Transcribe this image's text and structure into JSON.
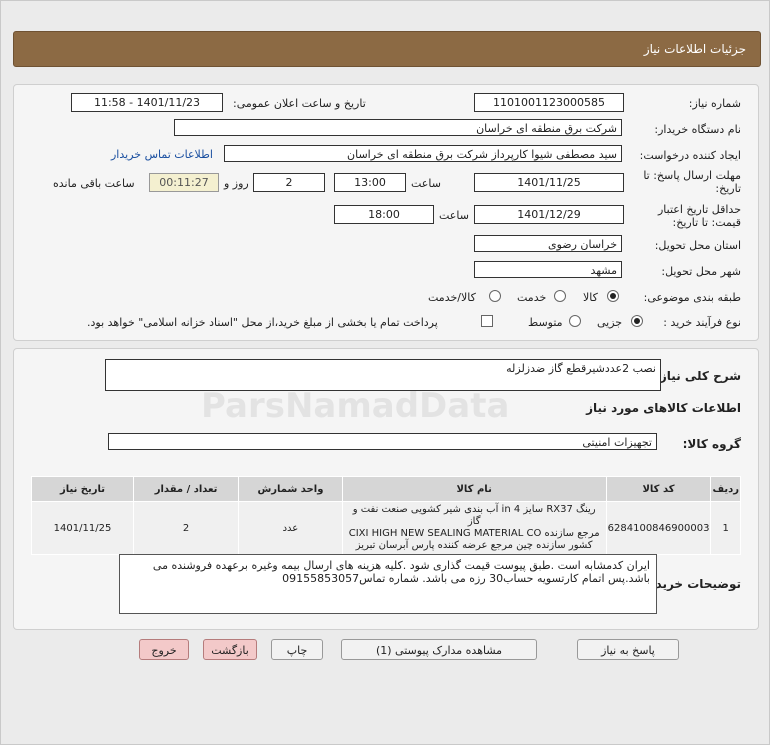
{
  "page": {
    "title": "جزئیات اطلاعات نیاز"
  },
  "watermark": {
    "text": "ParsNamadData"
  },
  "details": {
    "need_number_label": "شماره نیاز:",
    "need_number": "1101001123000585",
    "announce_label": "تاریخ و ساعت اعلان عمومی:",
    "announce_value": "1401/11/23 - 11:58",
    "buyer_org_label": "نام دستگاه خریدار:",
    "buyer_org": "شرکت برق منطقه ای خراسان",
    "requester_label": "ایجاد کننده درخواست:",
    "requester": "سید مصطفی شیوا کارپرداز شرکت برق منطقه ای خراسان",
    "contact_link": "اطلاعات تماس خریدار",
    "deadline_label_1": "مهلت ارسال پاسخ: تا",
    "deadline_label_2": "تاریخ:",
    "deadline_date": "1401/11/25",
    "time_label": "ساعت",
    "deadline_time": "13:00",
    "days_value": "2",
    "days_label": "روز و",
    "remaining_time": "00:11:27",
    "remaining_label": "ساعت باقی مانده",
    "validity_label_1": "حداقل تاریخ اعتبار",
    "validity_label_2": "قیمت: تا تاریخ:",
    "validity_date": "1401/12/29",
    "validity_time": "18:00",
    "province_label": "استان محل تحویل:",
    "province": "خراسان رضوی",
    "city_label": "شهر محل تحویل:",
    "city": "مشهد",
    "category_label": "طبقه بندی موضوعی:",
    "category_options": [
      "کالا",
      "خدمت",
      "کالا/خدمت"
    ],
    "process_label": "نوع فرآیند خرید :",
    "process_options": [
      "جزیی",
      "متوسط"
    ],
    "payment_note": "پرداخت تمام یا بخشی از مبلغ خرید،از محل \"اسناد خزانه اسلامی\" خواهد بود."
  },
  "need": {
    "summary_label": "شرح کلی نیاز:",
    "summary": "نصب 2عددشیرقطع گاز ضدزلزله",
    "goods_info_title": "اطلاعات کالاهای مورد نیاز",
    "group_label": "گروه کالا:",
    "group": "تجهیزات امنیتی"
  },
  "table": {
    "headers": [
      "ردیف",
      "کد کالا",
      "نام کالا",
      "واحد شمارش",
      "تعداد / مقدار",
      "تاریخ نیاز"
    ],
    "rows": [
      {
        "row": "1",
        "code": "6284100846900003",
        "name_line1": "رینگ RX37 سایز 4 in آب بندی شیر کشویی صنعت نفت و گاز",
        "name_line2": "مرجع سازنده CIXI HIGH NEW SEALING MATERIAL CO",
        "name_line3": "کشور سازنده چین مرجع عرضه کننده پارس آبرسان تبریز",
        "unit": "عدد",
        "qty": "2",
        "date": "1401/11/25"
      }
    ]
  },
  "buyer_notes": {
    "label": "توضیحات خریدار:",
    "text": "ایران کدمشابه است .طبق پیوست قیمت گذاری شود .کلیه هزینه های ارسال بیمه وغیره برعهده فروشنده می باشد.پس اتمام کارتسویه حساب30 رزه می باشد. شماره تماس09155853057"
  },
  "buttons": {
    "reply": "پاسخ به نیاز",
    "attachments": "مشاهده مدارک پیوستی (1)",
    "print": "چاپ",
    "back": "بازگشت",
    "exit": "خروج"
  }
}
